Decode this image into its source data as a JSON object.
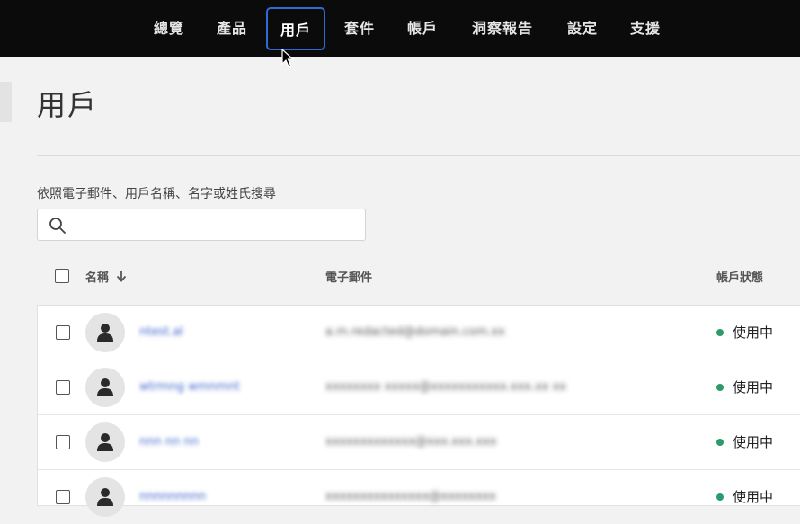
{
  "nav": {
    "items": [
      {
        "label": "總覽"
      },
      {
        "label": "產品"
      },
      {
        "label": "用戶"
      },
      {
        "label": "套件"
      },
      {
        "label": "帳戶"
      },
      {
        "label": "洞察報告"
      },
      {
        "label": "設定"
      },
      {
        "label": "支援"
      }
    ],
    "active_index": 2,
    "active_color": "#2f6bd8"
  },
  "page": {
    "title": "用戶"
  },
  "search": {
    "label": "依照電子郵件、用戶名稱、名字或姓氏搜尋",
    "value": "",
    "icon": "search-icon"
  },
  "table": {
    "columns": {
      "name": "名稱",
      "email": "電子郵件",
      "status": "帳戶狀態"
    },
    "sort_icon": "arrow-down-icon",
    "rows": [
      {
        "name": "ntest.al",
        "email": "a.m.redacted@domain.com.xx",
        "status": "使用中"
      },
      {
        "name": "wtrmng wmnmnt",
        "email": "xxxxxxxx xxxxx@xxxxxxxxxxx.xxx.xx xx",
        "status": "使用中"
      },
      {
        "name": "nnn nn nn",
        "email": "xxxxxxxxxxxxx@xxx.xxx.xxx",
        "status": "使用中"
      },
      {
        "name": "nnnnnnnnn",
        "email": "xxxxxxxxxxxxxxx@xxxxxxxx",
        "status": "使用中"
      }
    ],
    "status_color": "#2e9a6b"
  }
}
